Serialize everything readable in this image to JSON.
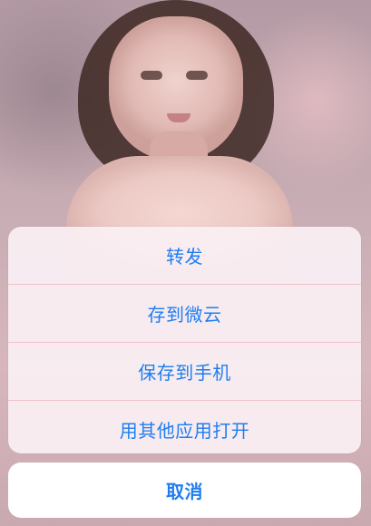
{
  "action_sheet": {
    "items": [
      {
        "label": "转发"
      },
      {
        "label": "存到微云"
      },
      {
        "label": "保存到手机"
      },
      {
        "label": "用其他应用打开"
      }
    ],
    "cancel_label": "取消"
  },
  "colors": {
    "accent": "#1f7df1",
    "sheet_background": "#faf0f4",
    "cancel_background": "#ffffff"
  }
}
